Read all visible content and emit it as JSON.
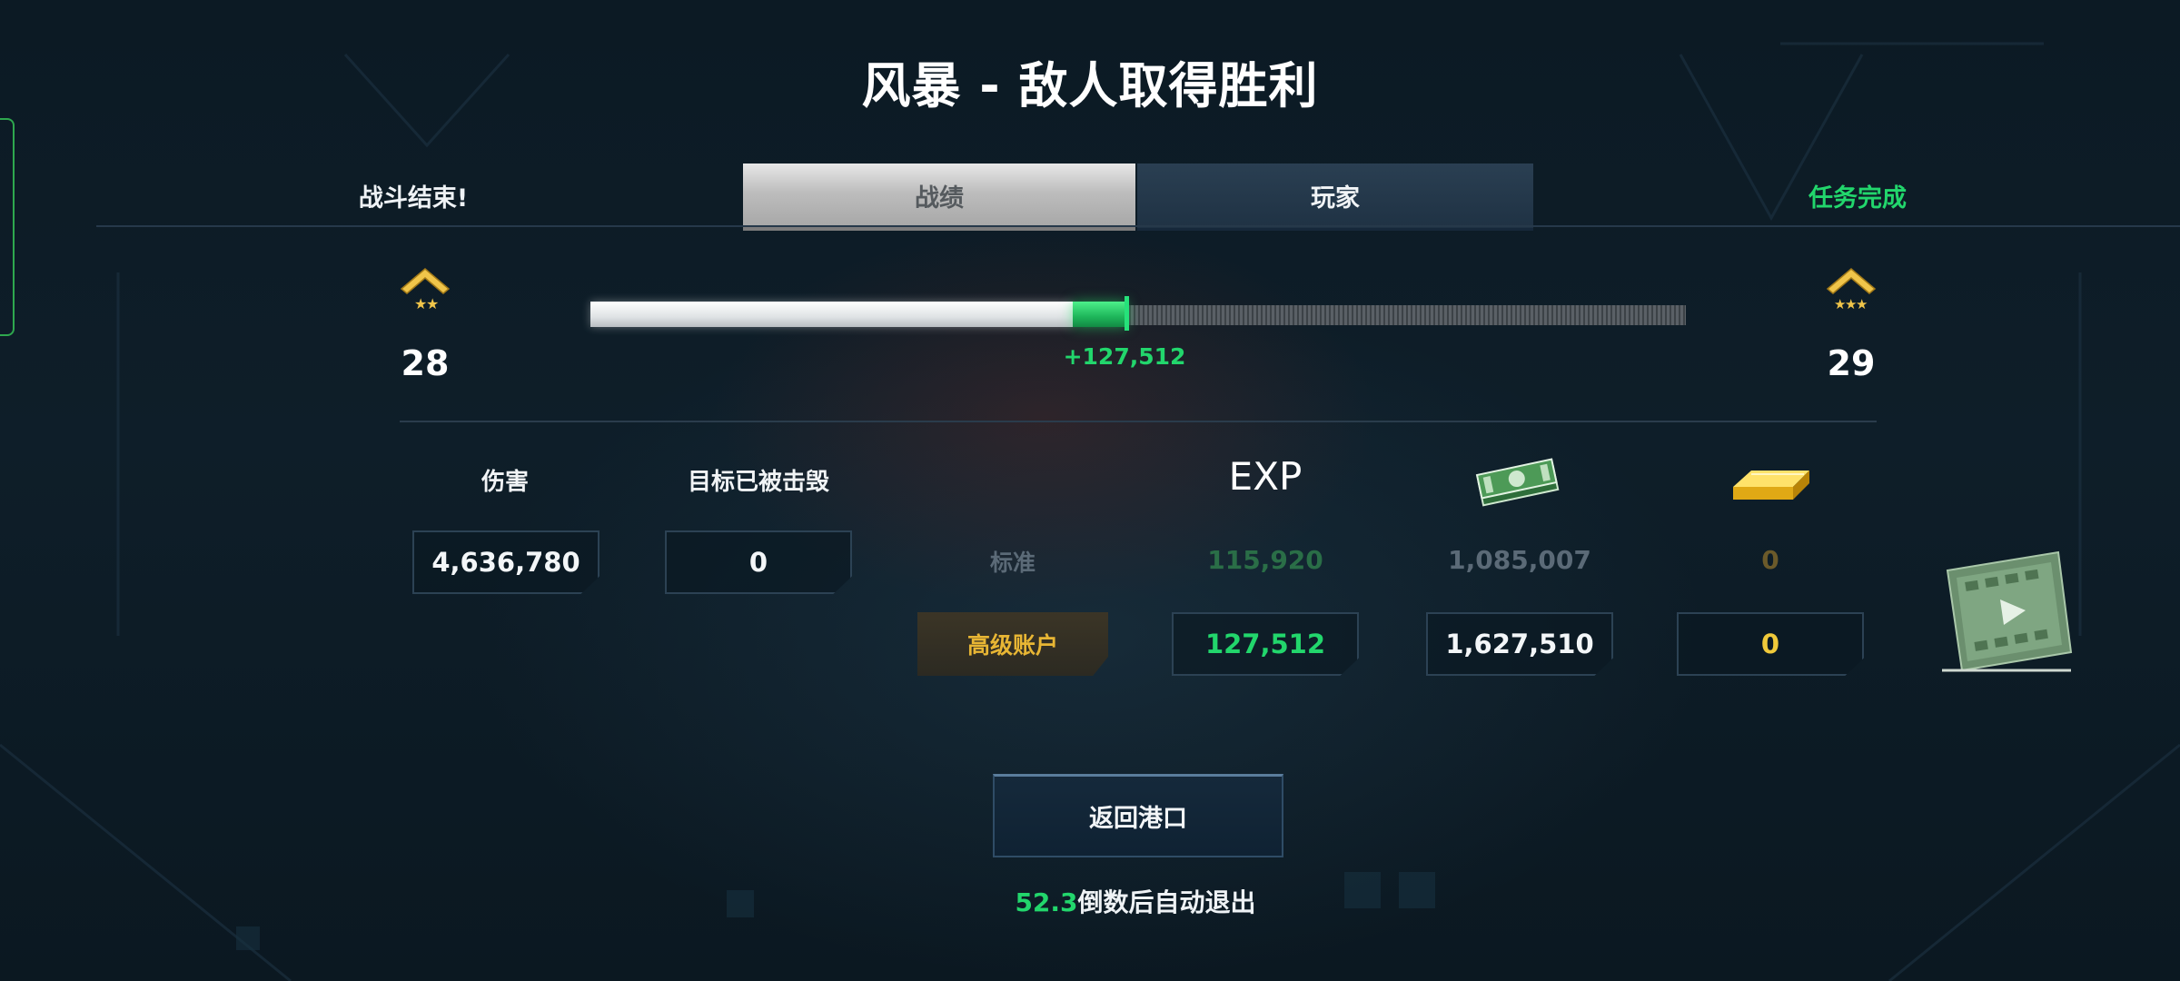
{
  "header": {
    "title": "风暴 - 敌人取得胜利"
  },
  "status": {
    "battle_over": "战斗结束!",
    "mission_done": "任务完成"
  },
  "tabs": [
    {
      "label": "战绩",
      "active": true
    },
    {
      "label": "玩家",
      "active": false
    }
  ],
  "progress": {
    "current_level": "28",
    "next_level": "29",
    "exp_gained": "+127,512",
    "prior_fill_fraction": 0.44,
    "gained_fill_fraction": 0.05
  },
  "stats": {
    "damage_label": "伤害",
    "damage_value": "4,636,780",
    "destroyed_label": "目标已被击毁",
    "destroyed_value": "0"
  },
  "rewards": {
    "exp_label": "EXP",
    "standard_label": "标准",
    "standard": {
      "exp": "115,920",
      "credits": "1,085,007",
      "gold": "0"
    },
    "premium_label": "高级账户",
    "premium": {
      "exp": "127,512",
      "credits": "1,627,510",
      "gold": "0"
    }
  },
  "icons": {
    "rank_current": "rank-chevron-2-stars-icon",
    "rank_next": "rank-chevron-3-stars-icon",
    "credits": "cash-stack-icon",
    "gold": "gold-bar-icon",
    "video": "video-reward-icon"
  },
  "colors": {
    "accent_green": "#22d66c",
    "gold": "#e8b634",
    "standard_exp": "#2a6e47",
    "standard_credits": "#5b6a77",
    "standard_gold": "#6b5a2a"
  },
  "footer": {
    "return_label": "返回港口",
    "countdown_value": "52.3",
    "countdown_text": "倒数后自动退出"
  }
}
